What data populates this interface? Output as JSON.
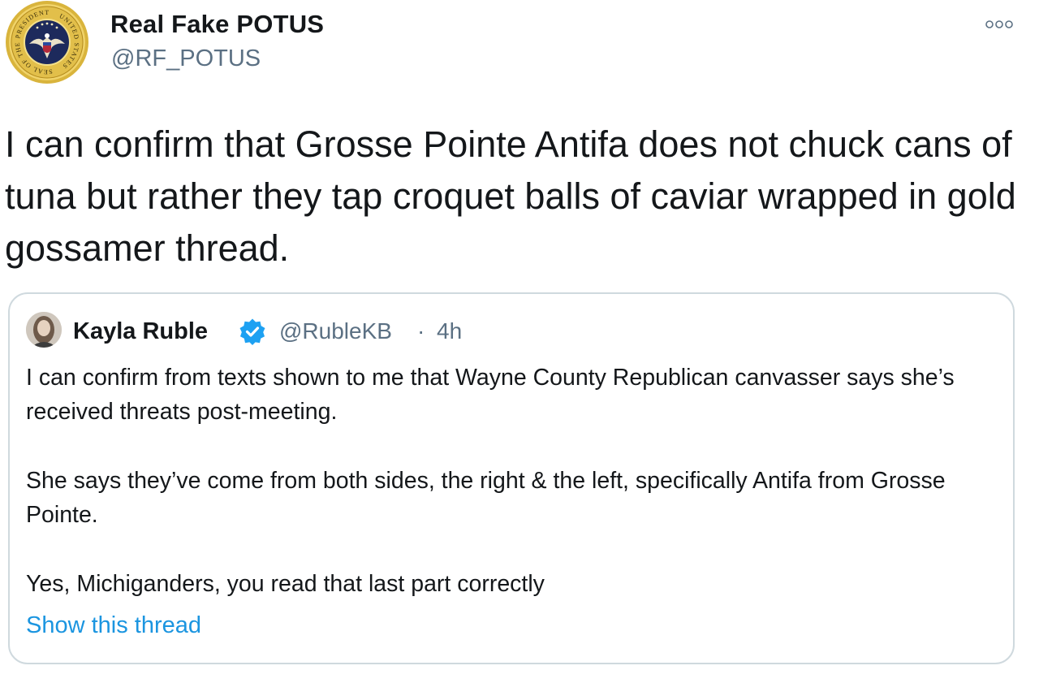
{
  "author": {
    "display_name": "Real Fake POTUS",
    "handle": "@RF_POTUS",
    "avatar_seal_text_top": "PRESIDENT",
    "avatar_seal_text_right": "UNITED STATES",
    "avatar_seal_text_left": "SEAL OF THE"
  },
  "tweet": {
    "text": "I can confirm that Grosse Pointe Antifa does not chuck cans of tuna but rather they tap croquet balls of caviar wrapped in gold gossamer thread."
  },
  "quoted_tweet": {
    "display_name": "Kayla Ruble",
    "handle": "@RubleKB",
    "separator": "·",
    "time": "4h",
    "paragraphs": [
      "I can confirm from texts shown to me that Wayne County Republican canvasser says she’s received threats post-meeting.",
      "She says they’ve come from both sides, the right & the left, specifically Antifa from Grosse Pointe.",
      "Yes, Michiganders, you read that last part correctly"
    ],
    "show_thread_label": "Show this thread"
  },
  "colors": {
    "text": "#14171a",
    "secondary": "#5b7083",
    "link": "#1b95e0",
    "border": "#cfd9de",
    "verified": "#1da1f2",
    "seal_gold": "#d9b43c",
    "seal_navy": "#1d2a5c"
  },
  "icons": {
    "more": "more-horizontal-icon",
    "verified": "verified-badge-icon",
    "seal": "presidential-seal-icon"
  }
}
